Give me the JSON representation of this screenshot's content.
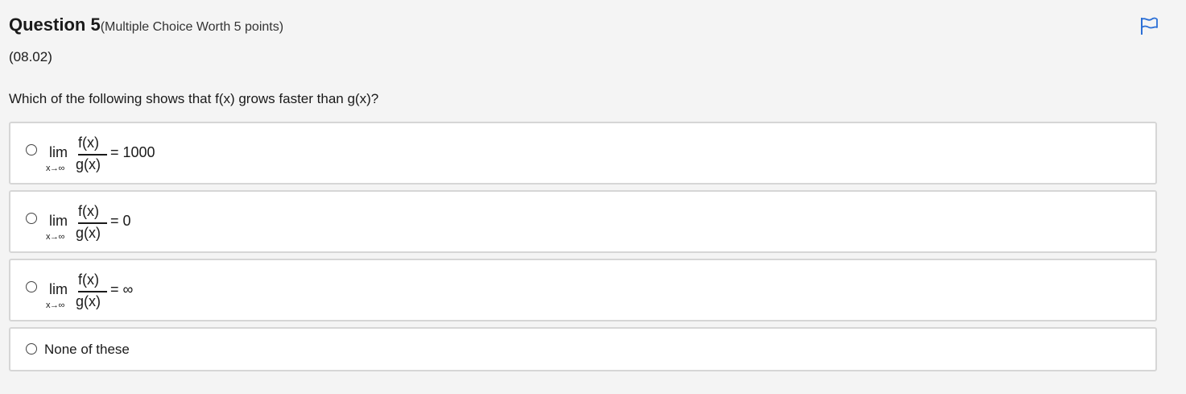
{
  "question": {
    "title": "Question 5",
    "subtitle": "(Multiple Choice Worth 5 points)",
    "code": "(08.02)",
    "prompt": "Which of the following shows that f(x) grows faster than g(x)?"
  },
  "icons": {
    "flag": "flag-icon",
    "flag_color": "#2b6fd6"
  },
  "options": [
    {
      "lim": "lim",
      "limit_sub": "x→∞",
      "numerator": "f(x)",
      "denominator": "g(x)",
      "rhs": "= 1000",
      "selected": false
    },
    {
      "lim": "lim",
      "limit_sub": "x→∞",
      "numerator": "f(x)",
      "denominator": "g(x)",
      "rhs": "= 0",
      "selected": false
    },
    {
      "lim": "lim",
      "limit_sub": "x→∞",
      "numerator": "f(x)",
      "denominator": "g(x)",
      "rhs": "= ∞",
      "selected": false
    },
    {
      "text": "None of these",
      "selected": false
    }
  ]
}
